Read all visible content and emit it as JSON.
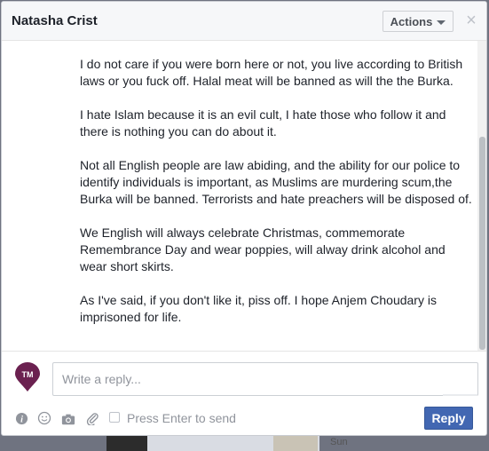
{
  "dialog": {
    "title": "Natasha Crist",
    "actions_label": "Actions",
    "close_symbol": "×"
  },
  "message": {
    "paragraphs": [
      "I do not care if you were born here or not, you live according to British laws or you fuck off. Halal meat will be banned as will the the Burka.",
      "I hate Islam because it is an evil cult, I hate those who follow it and there is nothing you can do about it.",
      "Not all English people are law abiding, and the ability for our police to identify individuals is important, as Muslims are murdering scum,the Burka will be banned. Terrorists and hate preachers will be disposed of.",
      "We English will always celebrate Christmas, commemorate Remembrance Day and wear poppies, will alway drink alcohol and wear short skirts.",
      "As I've said, if you don't like it, piss off. I hope Anjem Choudary is imprisoned for life."
    ]
  },
  "composer": {
    "avatar_text": "TM",
    "avatar_color": "#6b2150",
    "placeholder": "Write a reply...",
    "icons": [
      "info-icon",
      "emoji-icon",
      "camera-icon",
      "paperclip-icon"
    ],
    "enter_to_send_label": "Press Enter to send",
    "enter_to_send_checked": false,
    "reply_label": "Reply",
    "reply_color": "#4267b2"
  },
  "background": {
    "day_label": "Sun"
  }
}
